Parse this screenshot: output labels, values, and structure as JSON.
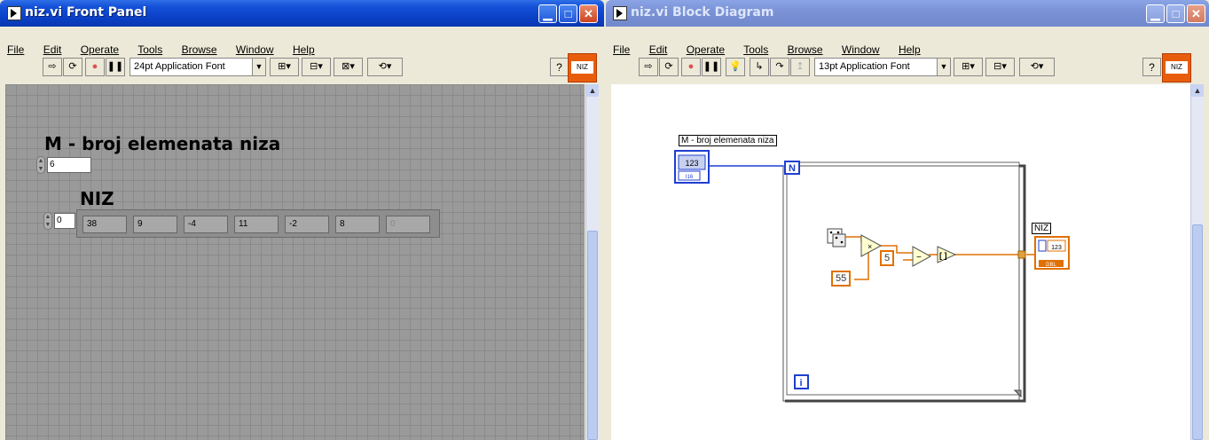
{
  "front_panel": {
    "title": "niz.vi Front Panel",
    "menu": [
      "File",
      "Edit",
      "Operate",
      "Tools",
      "Browse",
      "Window",
      "Help"
    ],
    "font_selector": "24pt Application Font",
    "vi_icon": "NIZ",
    "m_label": "M - broj elemenata niza",
    "m_value": "6",
    "array_label": "NIZ",
    "array_index": "0",
    "array_values": [
      "38",
      "9",
      "-4",
      "11",
      "-2",
      "8",
      "0"
    ]
  },
  "block_diagram": {
    "title": "niz.vi Block Diagram",
    "menu": [
      "File",
      "Edit",
      "Operate",
      "Tools",
      "Browse",
      "Window",
      "Help"
    ],
    "font_selector": "13pt Application Font",
    "vi_icon": "NIZ",
    "control_label": "M - broj elemenata niza",
    "control_terminal": "123",
    "count_terminal": "N",
    "iteration_terminal": "i",
    "constant_55": "55",
    "constant_5": "5",
    "indicator_label": "NIZ",
    "indicator_terminal": "123",
    "indicator_type": "DBL"
  },
  "colors": {
    "title_active": "#0a3fc4",
    "title_inactive": "#7b93d6",
    "wire_blue": "#1f3fd0",
    "wire_orange": "#e07000"
  }
}
